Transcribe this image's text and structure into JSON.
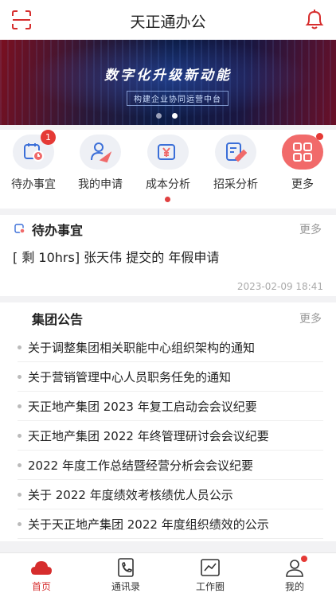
{
  "header": {
    "title": "天正通办公",
    "scan_icon": "scan-icon",
    "bell_icon": "bell-icon"
  },
  "banner": {
    "slogan": "数字化升级新动能",
    "subtitle": "构建企业协同运营中台",
    "slide_index": 2,
    "slide_count": 2
  },
  "quick_actions": [
    {
      "label": "待办事宜",
      "icon": "todo-calendar-icon",
      "badge": "1"
    },
    {
      "label": "我的申请",
      "icon": "my-application-icon"
    },
    {
      "label": "成本分析",
      "icon": "cost-analysis-icon"
    },
    {
      "label": "招采分析",
      "icon": "procurement-analysis-icon"
    },
    {
      "label": "更多",
      "icon": "grid-more-icon",
      "dot": true
    }
  ],
  "todo": {
    "title": "待办事宜",
    "more": "更多",
    "item": "[ 剩 10hrs] 张天伟 提交的 年假申请",
    "time": "2023-02-09 18:41"
  },
  "notice": {
    "title": "集团公告",
    "more": "更多",
    "items": [
      "关于调整集团相关职能中心组织架构的通知",
      "关于营销管理中心人员职务任免的通知",
      "天正地产集团 2023 年复工启动会会议纪要",
      "天正地产集团 2022 年终管理研讨会会议纪要",
      "2022 年度工作总结暨经营分析会会议纪要",
      "关于 2022 年度绩效考核绩优人员公示",
      "关于天正地产集团 2022 年度组织绩效的公示"
    ]
  },
  "tabbar": [
    {
      "label": "首页",
      "icon": "home-cloud-icon",
      "active": true
    },
    {
      "label": "通讯录",
      "icon": "contacts-icon"
    },
    {
      "label": "工作圈",
      "icon": "work-circle-icon"
    },
    {
      "label": "我的",
      "icon": "profile-icon",
      "dot": true
    }
  ],
  "colors": {
    "accent": "#d62d2d",
    "badge": "#e53935",
    "icon_blue": "#3b6fd8"
  }
}
